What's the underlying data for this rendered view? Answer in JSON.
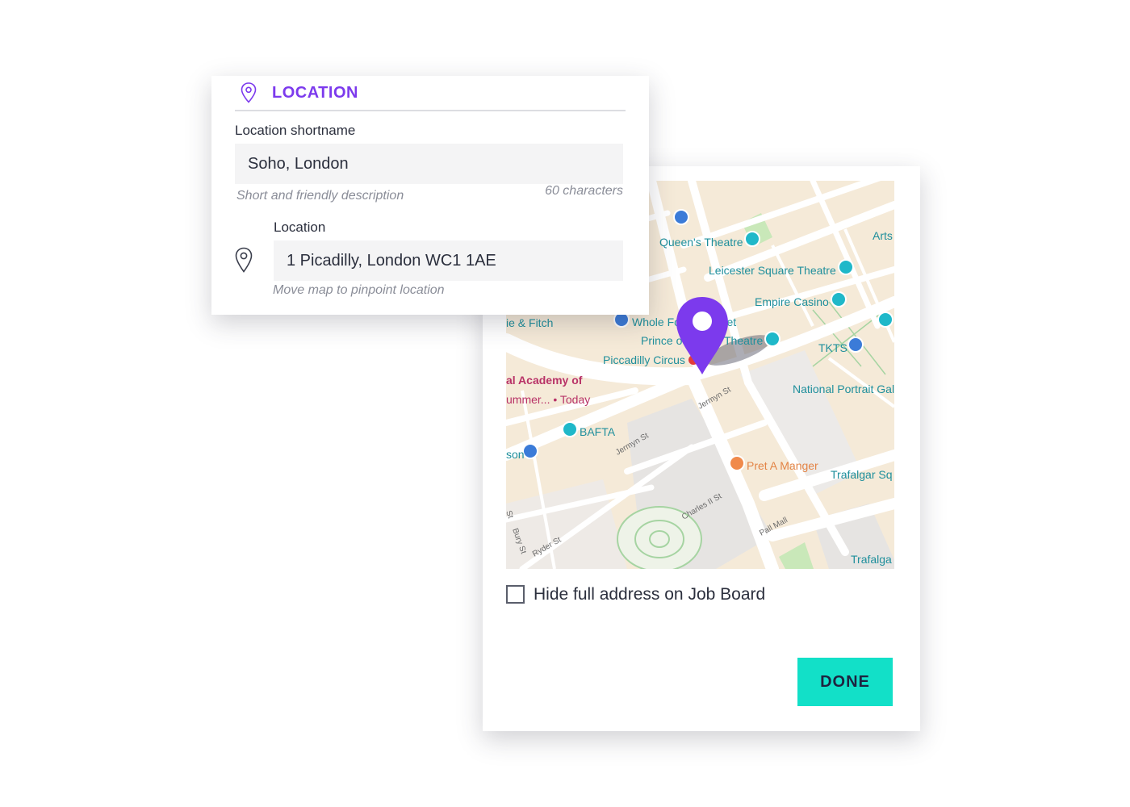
{
  "location_panel": {
    "title": "LOCATION",
    "shortname_label": "Location shortname",
    "shortname_value": "Soho, London",
    "shortname_hint": "Short and friendly description",
    "char_limit": "60 characters",
    "location_label": "Location",
    "location_value": "1 Picadilly, London WC1 1AE",
    "location_hint": "Move map to pinpoint location"
  },
  "map": {
    "places": {
      "queens_theatre": "Queen's Theatre",
      "arts": "Arts",
      "leicester_square_theatre": "Leicester Square Theatre",
      "empire_casino": "Empire Casino",
      "fitch": "ie & Fitch",
      "whole_foods": "Whole Foods Market",
      "prince": "Prince o",
      "theatre": "Theatre",
      "tkts": "TKTS",
      "piccadilly_circus": "Piccadilly Circus",
      "academy": "al Academy of",
      "academy_sub": "ummer... • Today",
      "national_portrait": "National Portrait Gal",
      "bafta": "BAFTA",
      "son": "son",
      "pret": "Pret A Manger",
      "trafalgar_sq": "Trafalgar Sq",
      "trafalgar": "Trafalga"
    },
    "streets": {
      "jermyn_1": "Jermyn St",
      "jermyn_2": "Jermyn St",
      "charles": "Charles II St",
      "pall_mall": "Pall Mall",
      "bury": "Bury St",
      "ryder": "Ryder St",
      "st": "St"
    },
    "colors": {
      "pin": "#7c3aed",
      "road": "#ffffff",
      "block": "#f5ead8",
      "park": "#c9e8b9",
      "poi": "#1fb8c9"
    }
  },
  "options": {
    "hide_address_label": "Hide full address on Job Board",
    "hide_address_checked": false
  },
  "actions": {
    "done_label": "DONE"
  }
}
